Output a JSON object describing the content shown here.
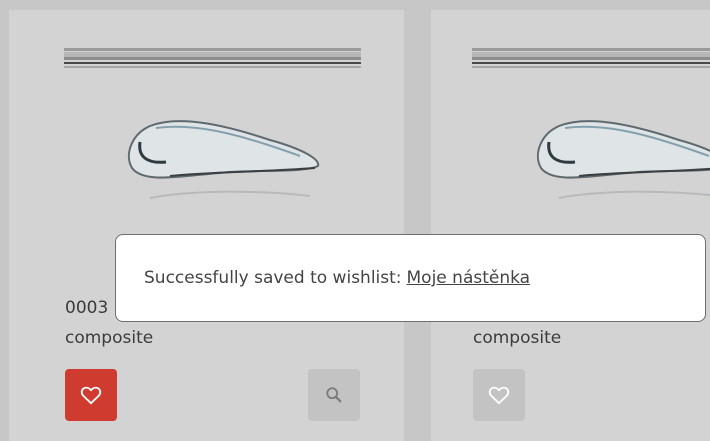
{
  "products": [
    {
      "code": "0003",
      "material": "composite",
      "wishlisted": true,
      "colors": {
        "wishlist_bg": "#cf3b2f",
        "wishlist_icon": "#ffffff"
      }
    },
    {
      "material": "composite",
      "wishlisted": false,
      "colors": {
        "wishlist_bg": "#c3c3c3",
        "wishlist_icon": "#ffffff"
      }
    }
  ],
  "buttons": {
    "search_icon": "magnifier-icon",
    "wishlist_icon": "heart-icon"
  },
  "toast": {
    "message": "Successfully saved to wishlist:",
    "link_text": "Moje nástěnka"
  },
  "colors": {
    "overlay": "#c7c7c7",
    "accent_red": "#cf3b2f"
  }
}
